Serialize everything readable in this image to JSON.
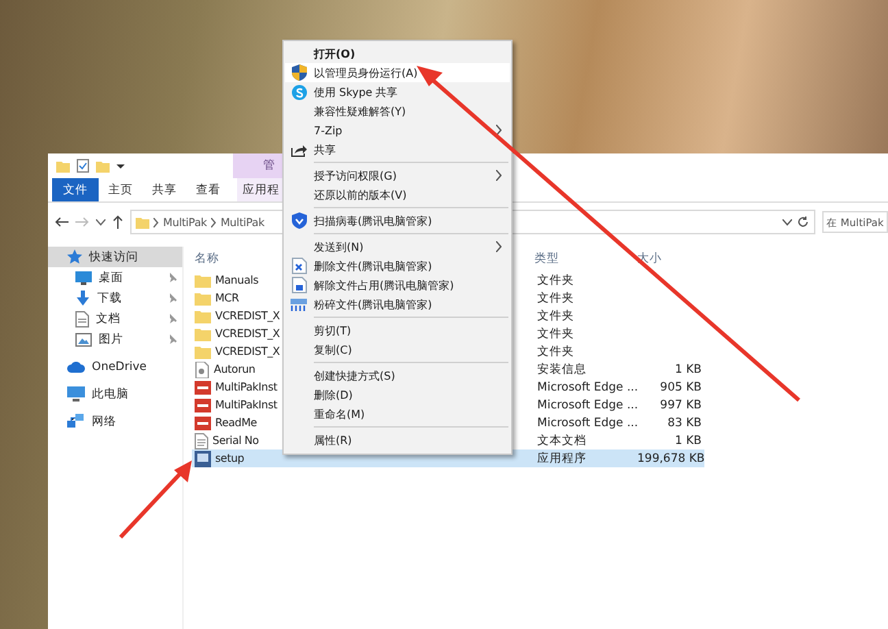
{
  "explorer": {
    "ribbon": {
      "context_group": "管",
      "tabs": [
        {
          "label": "文件",
          "kind": "file"
        },
        {
          "label": "主页",
          "kind": "tab"
        },
        {
          "label": "共享",
          "kind": "tab"
        },
        {
          "label": "查看",
          "kind": "tab"
        },
        {
          "label": "应用程",
          "kind": "context"
        }
      ]
    },
    "address": {
      "path": [
        "MultiPak",
        "MultiPak"
      ],
      "search": {
        "placeholder": "在 MultiPak"
      }
    },
    "nav": [
      {
        "label": "快速访问",
        "kind": "quick-access",
        "selected": true,
        "children": [
          {
            "label": "桌面",
            "kind": "desktop",
            "selected": false,
            "pinned": true
          },
          {
            "label": "下载",
            "kind": "downloads",
            "selected": false,
            "pinned": true
          },
          {
            "label": "文档",
            "kind": "documents",
            "selected": false,
            "pinned": true
          },
          {
            "label": "图片",
            "kind": "pictures",
            "selected": false,
            "pinned": true
          }
        ]
      },
      {
        "label": "OneDrive",
        "kind": "cloud",
        "selected": false
      },
      {
        "label": "此电脑",
        "kind": "computer",
        "selected": false
      },
      {
        "label": "网络",
        "kind": "network",
        "selected": false
      }
    ],
    "columns": [
      "名称",
      "类型",
      "大小"
    ],
    "rows": [
      {
        "name": "Manuals",
        "kind": "folder",
        "type": "文件夹",
        "size": "",
        "selected": false
      },
      {
        "name": "MCR",
        "kind": "folder",
        "type": "文件夹",
        "size": "",
        "selected": false
      },
      {
        "name": "VCREDIST_X",
        "kind": "folder",
        "type": "文件夹",
        "size": "",
        "selected": false
      },
      {
        "name": "VCREDIST_X",
        "kind": "folder",
        "type": "文件夹",
        "size": "",
        "selected": false
      },
      {
        "name": "VCREDIST_X",
        "kind": "folder",
        "type": "文件夹",
        "size": "",
        "selected": false
      },
      {
        "name": "Autorun",
        "kind": "settings-file",
        "type": "安装信息",
        "size": "1 KB",
        "selected": false
      },
      {
        "name": "MultiPakInst",
        "kind": "pdf",
        "type": "Microsoft Edge ...",
        "size": "905 KB",
        "selected": false
      },
      {
        "name": "MultiPakInst",
        "kind": "pdf",
        "type": "Microsoft Edge ...",
        "size": "997 KB",
        "selected": false
      },
      {
        "name": "ReadMe",
        "kind": "pdf",
        "type": "Microsoft Edge ...",
        "size": "83 KB",
        "selected": false
      },
      {
        "name": "Serial No",
        "kind": "text-file",
        "type": "文本文档",
        "size": "1 KB",
        "selected": false
      },
      {
        "name": "setup",
        "kind": "app",
        "type": "应用程序",
        "size": "199,678 KB",
        "selected": true
      }
    ]
  },
  "context_menu": {
    "items": [
      {
        "kind": "item",
        "label": "打开(O)",
        "bold": true,
        "selected": false
      },
      {
        "kind": "item",
        "label": "以管理员身份运行(A)",
        "selected": true
      },
      {
        "kind": "item",
        "label": "使用 Skype 共享",
        "selected": false
      },
      {
        "kind": "item",
        "label": "兼容性疑难解答(Y)",
        "selected": false
      },
      {
        "kind": "item",
        "label": "7-Zip",
        "submenu": true,
        "selected": false
      },
      {
        "kind": "item",
        "label": "共享",
        "selected": false
      },
      {
        "kind": "separator"
      },
      {
        "kind": "item",
        "label": "授予访问权限(G)",
        "submenu": true,
        "selected": false
      },
      {
        "kind": "item",
        "label": "还原以前的版本(V)",
        "selected": false
      },
      {
        "kind": "separator"
      },
      {
        "kind": "item",
        "label": "扫描病毒(腾讯电脑管家)",
        "selected": false
      },
      {
        "kind": "separator"
      },
      {
        "kind": "item",
        "label": "发送到(N)",
        "submenu": true,
        "selected": false
      },
      {
        "kind": "item",
        "label": "删除文件(腾讯电脑管家)",
        "selected": false
      },
      {
        "kind": "item",
        "label": "解除文件占用(腾讯电脑管家)",
        "selected": false
      },
      {
        "kind": "item",
        "label": "粉碎文件(腾讯电脑管家)",
        "selected": false
      },
      {
        "kind": "separator"
      },
      {
        "kind": "item",
        "label": "剪切(T)",
        "selected": false
      },
      {
        "kind": "item",
        "label": "复制(C)",
        "selected": false
      },
      {
        "kind": "separator"
      },
      {
        "kind": "item",
        "label": "创建快捷方式(S)",
        "selected": false
      },
      {
        "kind": "item",
        "label": "删除(D)",
        "selected": false
      },
      {
        "kind": "item",
        "label": "重命名(M)",
        "selected": false
      },
      {
        "kind": "separator"
      },
      {
        "kind": "item",
        "label": "属性(R)",
        "selected": false
      }
    ]
  }
}
